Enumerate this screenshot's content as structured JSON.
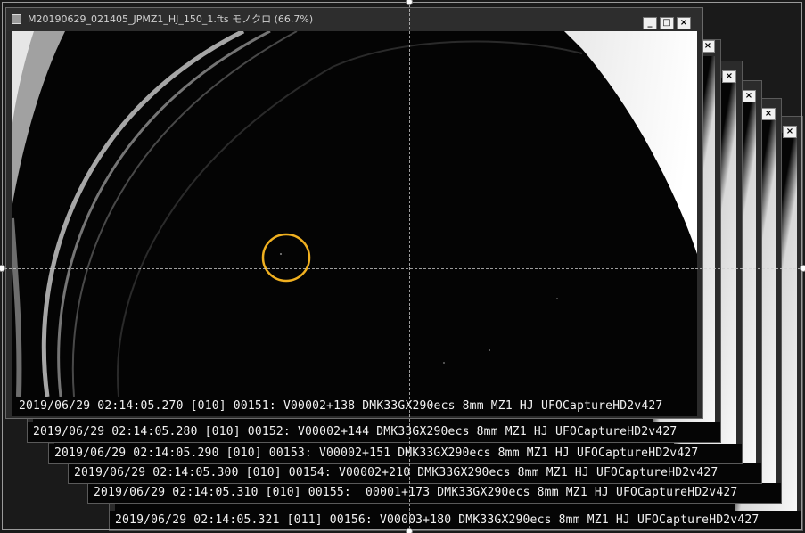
{
  "window": {
    "title": "M20190629_021405_JPMZ1_HJ_150_1.fts モノクロ (66.7%)",
    "buttons": {
      "minimize": "_",
      "maximize": "□",
      "close": "×"
    }
  },
  "main_caption": "2019/06/29 02:14:05.270 [010] 00151: V00002+138 DMK33GX290ecs 8mm MZ1 HJ UFOCaptureHD2v427",
  "stacked_frames": [
    {
      "caption": "2019/06/29 02:14:05.280 [010] 00152: V00002+144 DMK33GX290ecs 8mm MZ1 HJ UFOCaptureHD2v427",
      "close": "×"
    },
    {
      "caption": "2019/06/29 02:14:05.290 [010] 00153: V00002+151 DMK33GX290ecs 8mm MZ1 HJ UFOCaptureHD2v427",
      "close": "×"
    },
    {
      "caption": "2019/06/29 02:14:05.300 [010] 00154: V00002+210 DMK33GX290ecs 8mm MZ1 HJ UFOCaptureHD2v427",
      "close": "×"
    },
    {
      "caption": "2019/06/29 02:14:05.310 [010] 00155:  00001+173 DMK33GX290ecs 8mm MZ1 HJ UFOCaptureHD2v427",
      "close": "×"
    },
    {
      "caption": "2019/06/29 02:14:05.321 [011] 00156: V00003+180 DMK33GX290ecs 8mm MZ1 HJ UFOCaptureHD2v427",
      "close": "×"
    }
  ],
  "colors": {
    "highlight_ring": "#f0b020",
    "guides": "#cfcfcf"
  }
}
